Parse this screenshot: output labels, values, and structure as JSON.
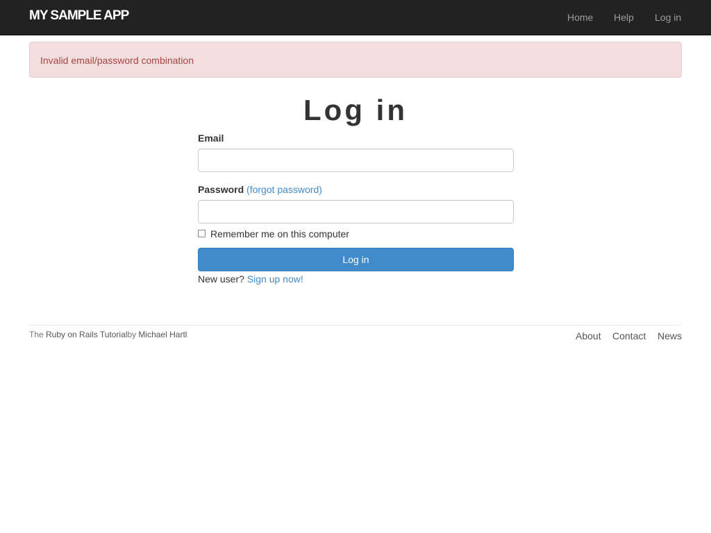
{
  "navbar": {
    "brand": "MY SAMPLE APP",
    "links": [
      "Home",
      "Help",
      "Log in"
    ]
  },
  "alert": {
    "message": "Invalid email/password combination"
  },
  "login_form": {
    "title": "Log in",
    "email_label": "Email",
    "email_value": "",
    "password_label": "Password",
    "forgot_link": "(forgot password)",
    "password_value": "",
    "remember_label": "Remember me on this computer",
    "remember_checked": false,
    "submit_label": "Log in",
    "new_user_text": "New user?",
    "signup_link": "Sign up now!"
  },
  "footer": {
    "credit_prefix": "The ",
    "credit_link": "Ruby on Rails Tutorial",
    "credit_by": "by ",
    "credit_author": "Michael Hartl",
    "links": [
      "About",
      "Contact",
      "News"
    ]
  },
  "colors": {
    "navbar_bg": "#222222",
    "alert_bg": "#f2dede",
    "alert_text": "#a94442",
    "primary": "#428bca"
  }
}
